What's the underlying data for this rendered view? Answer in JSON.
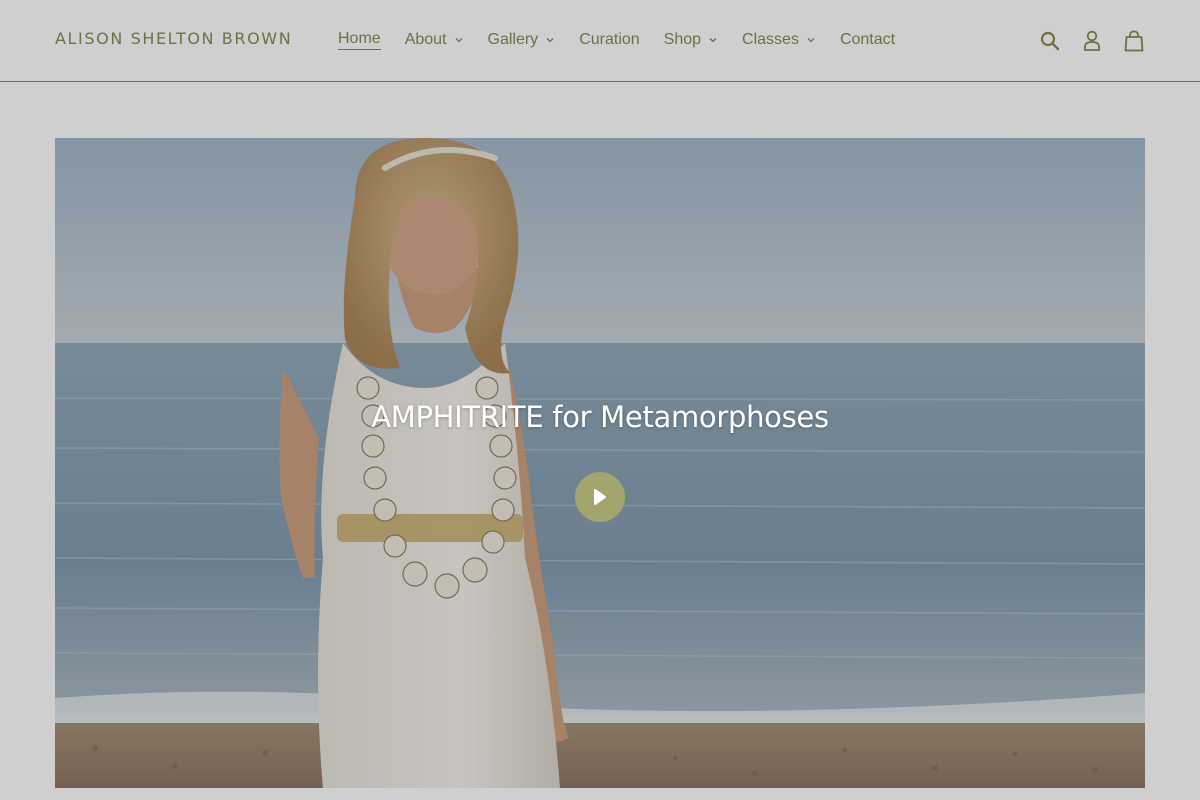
{
  "header": {
    "logo": "ALISON SHELTON BROWN",
    "nav": [
      {
        "label": "Home",
        "active": true,
        "has_dropdown": false
      },
      {
        "label": "About",
        "active": false,
        "has_dropdown": true
      },
      {
        "label": "Gallery",
        "active": false,
        "has_dropdown": true
      },
      {
        "label": "Curation",
        "active": false,
        "has_dropdown": false
      },
      {
        "label": "Shop",
        "active": false,
        "has_dropdown": true
      },
      {
        "label": "Classes",
        "active": false,
        "has_dropdown": true
      },
      {
        "label": "Contact",
        "active": false,
        "has_dropdown": false
      }
    ],
    "icons": [
      "search-icon",
      "account-icon",
      "cart-icon"
    ]
  },
  "hero": {
    "title": "AMPHITRITE for Metamorphoses",
    "play_icon": "play-icon"
  },
  "colors": {
    "background": "#cfcfcf",
    "accent": "#6f7042",
    "play_button": "#a3a46e",
    "title_text": "#ffffff"
  }
}
